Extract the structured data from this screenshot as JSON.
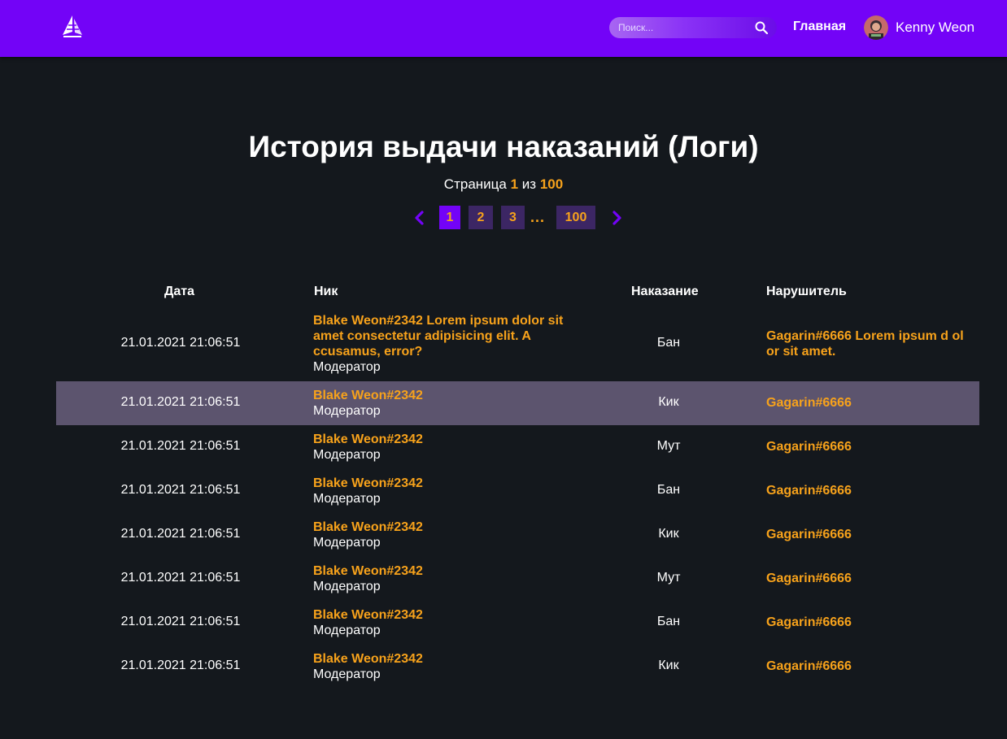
{
  "header": {
    "search_placeholder": "Поиск...",
    "home_label": "Главная",
    "username": "Kenny Weon",
    "icons": {
      "logo": "logo-icon",
      "search": "search-icon",
      "avatar": "avatar"
    }
  },
  "page": {
    "title": "История выдачи наказаний (Логи)",
    "page_prefix": "Страница",
    "current_page": "1",
    "of_word": "из",
    "total_pages": "100"
  },
  "pagination": {
    "prev_icon": "chevron-left-icon",
    "next_icon": "chevron-right-icon",
    "pages": [
      "1",
      "2",
      "3",
      "100"
    ],
    "ellipsis": "...",
    "active": "1"
  },
  "table": {
    "headers": {
      "date": "Дата",
      "nick": "Ник",
      "punishment": "Наказание",
      "offender": "Нарушитель"
    },
    "rows": [
      {
        "date": "21.01.2021 21:06:51",
        "nick": "Blake Weon#2342 Lorem ipsum dolor sit amet consectetur adipisicing elit. A ccusamus, error?",
        "role": "Модератор",
        "punishment": "Бан",
        "offender": "Gagarin#6666 Lorem ipsum d olor sit amet."
      },
      {
        "date": "21.01.2021 21:06:51",
        "nick": "Blake Weon#2342",
        "role": "Модератор",
        "punishment": "Кик",
        "offender": "Gagarin#6666"
      },
      {
        "date": "21.01.2021 21:06:51",
        "nick": "Blake Weon#2342",
        "role": "Модератор",
        "punishment": "Мут",
        "offender": "Gagarin#6666"
      },
      {
        "date": "21.01.2021 21:06:51",
        "nick": "Blake Weon#2342",
        "role": "Модератор",
        "punishment": "Бан",
        "offender": "Gagarin#6666"
      },
      {
        "date": "21.01.2021 21:06:51",
        "nick": "Blake Weon#2342",
        "role": "Модератор",
        "punishment": "Кик",
        "offender": "Gagarin#6666"
      },
      {
        "date": "21.01.2021 21:06:51",
        "nick": "Blake Weon#2342",
        "role": "Модератор",
        "punishment": "Мут",
        "offender": "Gagarin#6666"
      },
      {
        "date": "21.01.2021 21:06:51",
        "nick": "Blake Weon#2342",
        "role": "Модератор",
        "punishment": "Бан",
        "offender": "Gagarin#6666"
      },
      {
        "date": "21.01.2021 21:06:51",
        "nick": "Blake Weon#2342",
        "role": "Модератор",
        "punishment": "Кик",
        "offender": "Gagarin#6666"
      }
    ]
  },
  "colors": {
    "accent": "#7303f7",
    "highlight": "#f7a21b",
    "background": "#14181d",
    "row_hover": "#5c546e",
    "page_button": "#3c2664"
  }
}
